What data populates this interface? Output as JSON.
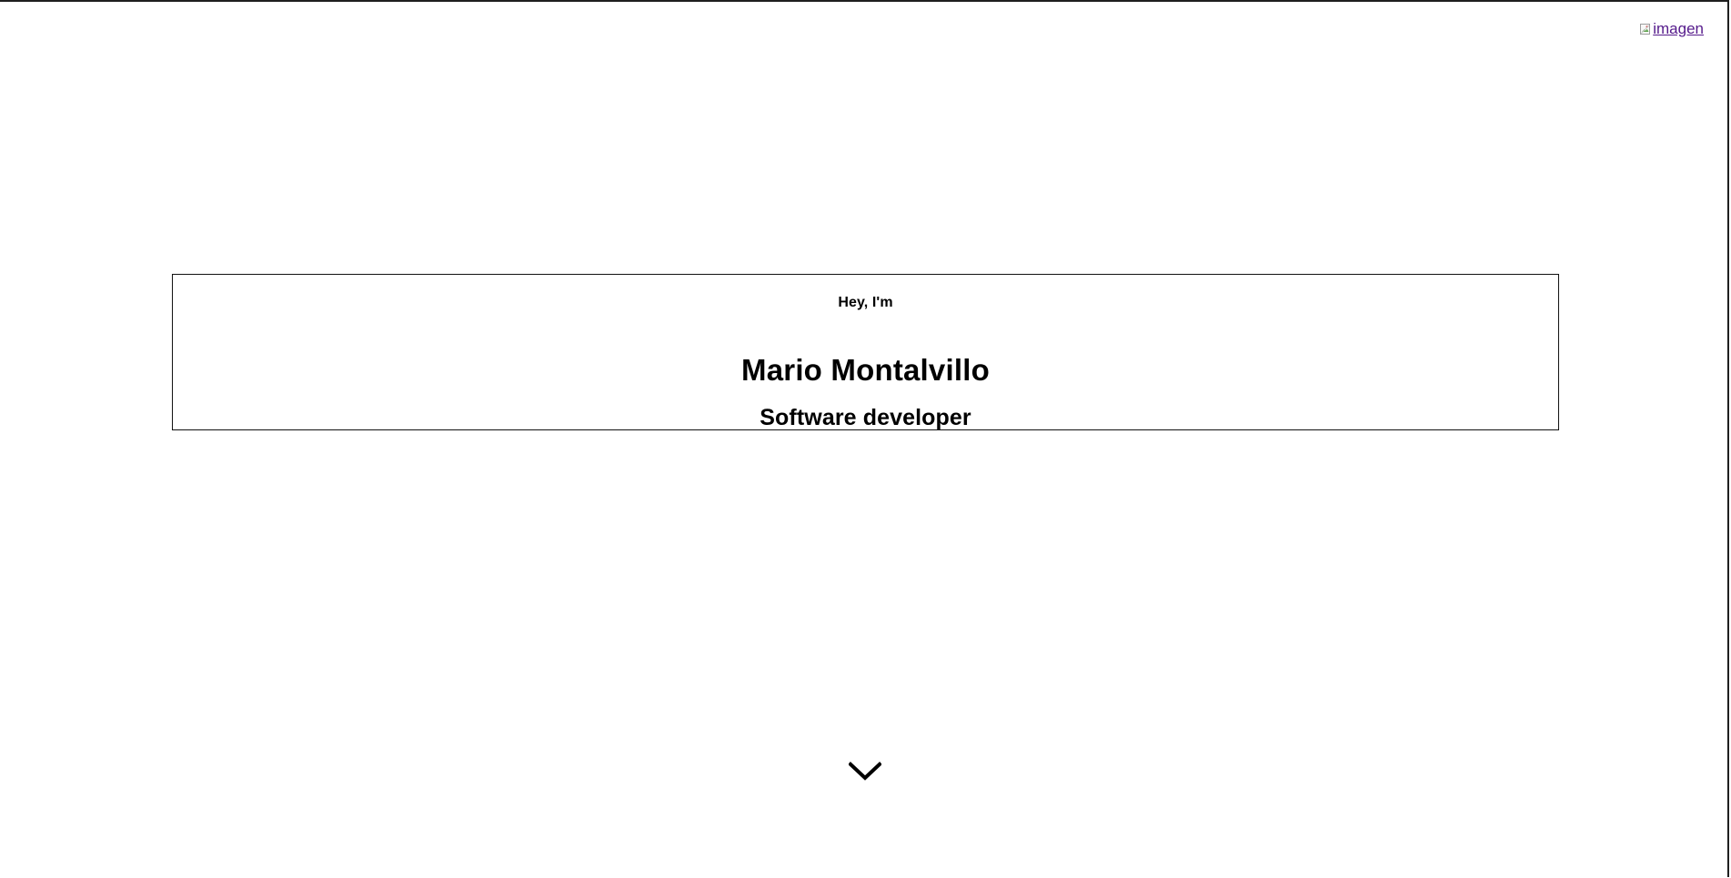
{
  "header": {
    "image_link_text": "imagen",
    "image_icon": "broken-image-icon"
  },
  "hero": {
    "greeting": "Hey, I'm",
    "name": "Mario Montalvillo",
    "role": "Software developer"
  },
  "scroll": {
    "icon": "chevron-down-icon"
  },
  "colors": {
    "background": "#ffffff",
    "text": "#000000",
    "link": "#551a8b",
    "border": "#111111"
  }
}
